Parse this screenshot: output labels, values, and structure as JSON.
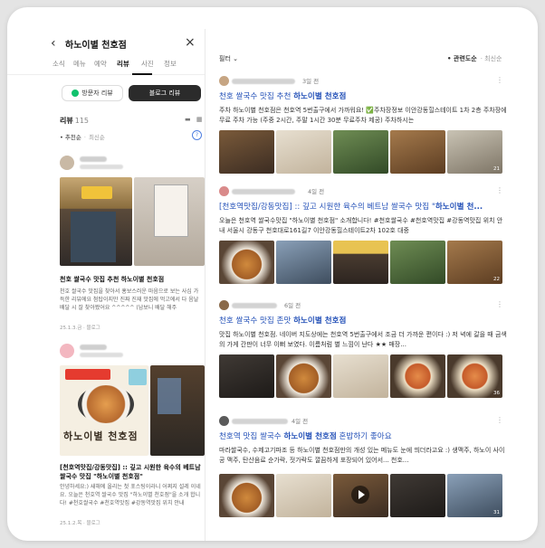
{
  "left": {
    "back_icon": "chevron-left-icon",
    "place_name": "하노이별 천호점",
    "close_icon": "close-icon",
    "tabs": [
      {
        "label": "소식"
      },
      {
        "label": "메뉴"
      },
      {
        "label": "예약"
      },
      {
        "label": "리뷰",
        "active": true
      },
      {
        "label": "사진"
      },
      {
        "label": "정보"
      }
    ],
    "visitor_review_label": "방문자 리뷰",
    "blog_review_label": "블로그 리뷰",
    "review_label": "리뷰",
    "review_count": "115",
    "sort_recommended": "추천순",
    "sort_latest": "최신순",
    "info_icon": "info-icon",
    "posts": [
      {
        "title": "천호 쌀국수 맛집 추천 하노이별 천호점",
        "body": "천호 쌀국수 맛집을 찾아서 홍보스러운 마음으로 보는 사심 가득한 리뷰에요 첨탑이지만 진짜 진재 맛집에 먹고에서 다 음날 배달 시 잘 찾아봤어요 ^^^^^ (남보니 배달 해주",
        "meta": "25.1.3.금 · 블로그"
      },
      {
        "title": "[천호역맛집/강동맛집] :: 깊고 시원한 육수의 베트남 쌀국수 맛집 \"하노이별 천호점\"",
        "body": "안녕하세요:) 새해에 올리는 첫 포스팅이라니 어쩌지 설레 이네요. 오늘은 천호역 쌀국수 맛집 \"하노이별 천호점\"을 소개 합니다! #천호쌀국수 #천호역맛집 #강동역맛집 위치 안내",
        "meta": "25.1.2.목 · 블로그",
        "logo_text": "하노이별 천호점"
      }
    ]
  },
  "right": {
    "filter_label": "필터",
    "sort_relevance": "관련도순",
    "sort_latest": "최신순",
    "posts": [
      {
        "date": "3일 전",
        "title_pre": "천호 쌀국수 맛집 추천 ",
        "title_bold": "하노이별 천호점",
        "title_post": "",
        "text": "주차 하노이별 천호점은 천호역 5번출구에서 가까워요! ✅주차장정보 이안강동힐스테이트 1차 2층 주차장에 무료 주차 가능 (주중 2시간, 주말 1시간 30분 무료주차 제공) 주차하시는",
        "thumb_count": "21"
      },
      {
        "date": "4일 전",
        "title_pre": "[천호역맛집/강동맛집] :: 깊고 시원한 육수의 베트남 쌀국수 맛집 \"",
        "title_bold": "하노이별 천...",
        "title_post": "",
        "text": "오늘은 천호역 쌀국수맛집 \"하노이별 천호점\" 소개합니다! #천호쌀국수 #천호역맛집 #강동역맛집 위치 안내 서울시 강동구 천호대로161길7 이안강동힐스테이트2차 102호 대중",
        "thumb_count": "22"
      },
      {
        "date": "6일 전",
        "title_pre": "천호 쌀국수 맛집 존맛 ",
        "title_bold": "하노이별 천호점",
        "title_post": "",
        "text": "맛집 하노이별 천호점. 네이버 지도상에는 천호역 5번출구에서 조금 더 가까운 편이다 :) 저 녁에 갈을 때 금색의 가게 간판이 너무 이뻐 보였다. 이름처럼 별 느낌이 난다 ★★ 매장...",
        "thumb_count": "36"
      },
      {
        "date": "4일 전",
        "title_pre": "천호역 맛집 쌀국수 ",
        "title_bold": "하노이별 천호점",
        "title_post": " 혼밥하기 좋아요",
        "text": "마라쌀국수, 수제고기파조 등 하노이별 천호점만의 개성 있는 메뉴도 눈에 띄더라고요 :) 생맥주, 하노이 사이공 맥주, 탄산음료 순가락, 젓가락도 깔끔하게 포장되어 있어서... 천호...",
        "thumb_count": "31"
      }
    ],
    "more_icon": "more-vertical-icon",
    "play_icon": "play-icon"
  }
}
